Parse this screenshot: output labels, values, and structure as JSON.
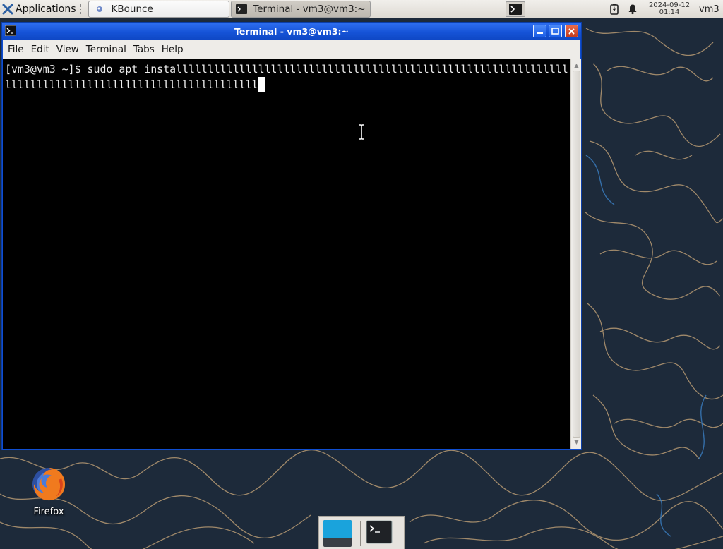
{
  "desktop": {
    "colors": {
      "wallpaper": "#1d2a3a",
      "line_tan": "#b79a73",
      "line_blue": "#3b7fc4"
    },
    "icons": [
      {
        "label": "Firefox",
        "icon": "firefox-icon"
      }
    ]
  },
  "top_panel": {
    "applications_label": "Applications",
    "tasks": [
      {
        "label": "KBounce",
        "icon": "kbounce-icon"
      },
      {
        "label": "Terminal - vm3@vm3:~",
        "icon": "terminal-icon"
      }
    ],
    "clock": {
      "date": "2024-09-12",
      "time": "01:14"
    },
    "user": "vm3"
  },
  "terminal_window": {
    "title": "Terminal - vm3@vm3:~",
    "menu": [
      "File",
      "Edit",
      "View",
      "Terminal",
      "Tabs",
      "Help"
    ],
    "prompt": "[vm3@vm3 ~]$ ",
    "command": "sudo apt installllllllllllllllllllllllllllllllllllllllllllllllllllllllllllllllllllllllllllllllllllllllllllllllllllll",
    "colors": {
      "titlebar": "#1552d6",
      "background": "#000000",
      "foreground": "#ececec"
    }
  },
  "dock": {
    "items": [
      {
        "name": "show-desktop",
        "icon": "show-desktop-icon"
      },
      {
        "name": "terminal",
        "icon": "terminal-icon"
      }
    ]
  }
}
